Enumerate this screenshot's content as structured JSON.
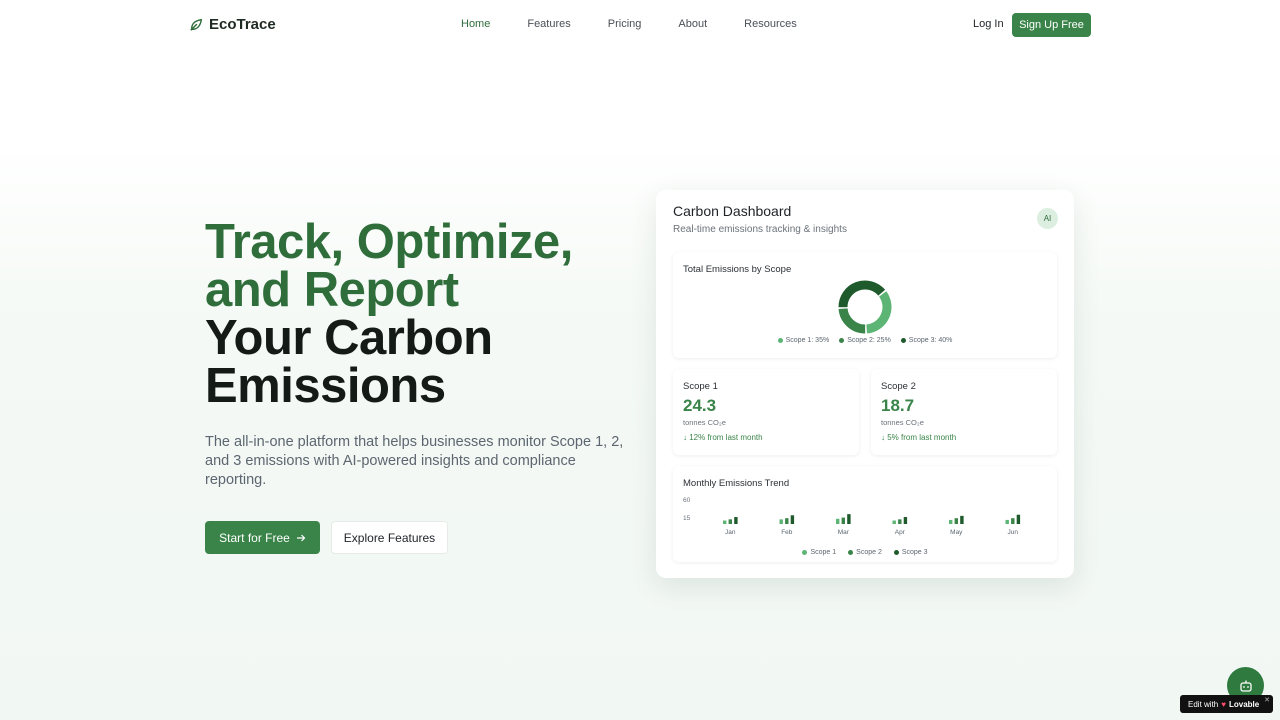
{
  "nav": {
    "logo": "EcoTrace",
    "links": [
      {
        "label": "Home",
        "active": true
      },
      {
        "label": "Features",
        "active": false
      },
      {
        "label": "Pricing",
        "active": false
      },
      {
        "label": "About",
        "active": false
      },
      {
        "label": "Resources",
        "active": false
      }
    ],
    "login": "Log In",
    "signup": "Sign Up Free"
  },
  "hero": {
    "line1": "Track, Optimize,",
    "line2": "and Report",
    "line3": "Your Carbon",
    "line4": "Emissions",
    "subtitle": "The all-in-one platform that helps businesses monitor Scope 1, 2, and 3 emissions with AI-powered insights and compliance reporting.",
    "cta_primary": "Start for Free",
    "cta_secondary": "Explore Features"
  },
  "dashboard": {
    "title": "Carbon Dashboard",
    "subtitle": "Real-time emissions tracking & insights",
    "ai_badge": "AI",
    "donut_title": "Total Emissions by Scope",
    "scope1": {
      "label": "Scope 1",
      "value": "24.3",
      "unit": "tonnes CO₂e",
      "change": "↓ 12% from last month"
    },
    "scope2": {
      "label": "Scope 2",
      "value": "18.7",
      "unit": "tonnes CO₂e",
      "change": "↓ 5% from last month"
    },
    "trend_title": "Monthly Emissions Trend"
  },
  "colors": {
    "scope1": "#5cb574",
    "scope2": "#3a8449",
    "scope3": "#1f5a2c"
  },
  "chart_data": [
    {
      "type": "pie",
      "title": "Total Emissions by Scope",
      "categories": [
        "Scope 1",
        "Scope 2",
        "Scope 3"
      ],
      "values": [
        35,
        25,
        40
      ],
      "legend": [
        "Scope 1: 35%",
        "Scope 2: 25%",
        "Scope 3: 40%"
      ]
    },
    {
      "type": "bar",
      "title": "Monthly Emissions Trend",
      "categories": [
        "Jan",
        "Feb",
        "Mar",
        "Apr",
        "May",
        "Jun"
      ],
      "yticks": [
        "60",
        "15"
      ],
      "ylim": [
        0,
        60
      ],
      "series": [
        {
          "name": "Scope 1",
          "values": [
            6,
            8,
            9,
            6,
            7,
            7
          ]
        },
        {
          "name": "Scope 2",
          "values": [
            8,
            10,
            11,
            8,
            10,
            10
          ]
        },
        {
          "name": "Scope 3",
          "values": [
            12,
            15,
            17,
            12,
            14,
            16
          ]
        }
      ]
    }
  ],
  "floating": {
    "badge_prefix": "Edit with",
    "badge_brand": "Lovable"
  }
}
